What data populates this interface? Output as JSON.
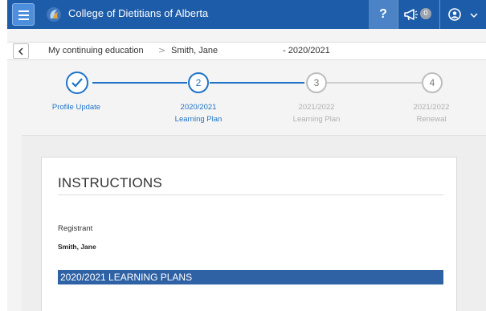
{
  "header": {
    "app_title": "College of Dietitians of Alberta",
    "help_label": "?",
    "notifications_count": "0",
    "icons": [
      "menu-icon",
      "college-logo-icon",
      "megaphone-icon",
      "user-circle-icon",
      "chevron-down-icon"
    ],
    "brand_color": "#1d5ca8"
  },
  "breadcrumb": {
    "items": [
      "My continuing education",
      "Smith, Jane",
      "- 2020/2021"
    ],
    "separator": ">"
  },
  "stepper": {
    "steps": [
      {
        "number": "1",
        "label_line1": "Profile Update",
        "label_line2": "",
        "state": "done"
      },
      {
        "number": "2",
        "label_line1": "2020/2021",
        "label_line2": "Learning Plan",
        "state": "active"
      },
      {
        "number": "3",
        "label_line1": "2021/2022",
        "label_line2": "Learning Plan",
        "state": "pending"
      },
      {
        "number": "4",
        "label_line1": "2021/2022",
        "label_line2": "Renewal",
        "state": "pending"
      }
    ],
    "active_color": "#1f74c7"
  },
  "main": {
    "title": "INSTRUCTIONS",
    "registrant_label": "Registrant",
    "registrant_name": "Smith, Jane",
    "section_heading": "2020/2021 LEARNING PLANS",
    "section_color": "#2f62a5"
  }
}
